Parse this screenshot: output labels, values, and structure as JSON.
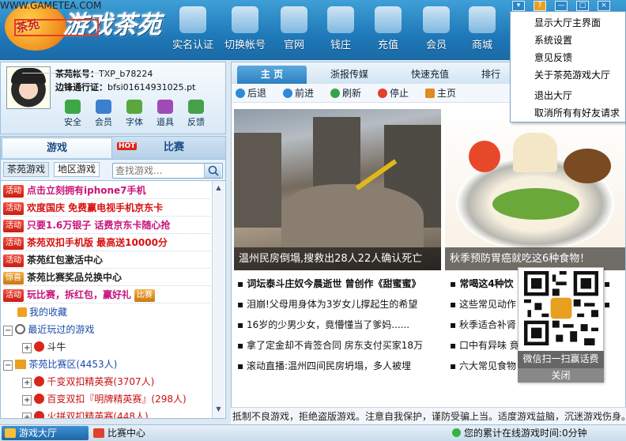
{
  "header": {
    "logo_text": "游戏茶苑",
    "logo_badge": "茶苑",
    "logo_url": "WWW.GAMETEA.COM",
    "nav": [
      {
        "label": "实名认证",
        "icon": "id-card-icon"
      },
      {
        "label": "切换帐号",
        "icon": "switch-account-icon"
      },
      {
        "label": "官网",
        "icon": "home-icon"
      },
      {
        "label": "钱庄",
        "icon": "bank-icon"
      },
      {
        "label": "充值",
        "icon": "recharge-icon"
      },
      {
        "label": "会员",
        "icon": "diamond-icon"
      },
      {
        "label": "商城",
        "icon": "cart-icon"
      }
    ],
    "window_controls": [
      "▾",
      "?",
      "—",
      "□",
      "×"
    ]
  },
  "menu": {
    "items": [
      "显示大厅主界面",
      "系统设置",
      "意见反馈",
      "关于茶苑游戏大厅",
      "退出大厅",
      "取消所有有好友请求"
    ],
    "highlighted": "系统设置"
  },
  "profile": {
    "account_label": "茶苑帐号：",
    "account_value": "TXP_b78224",
    "pass_label": "边锋通行证：",
    "pass_value": "bfsi01614931025.pt",
    "tools": [
      "安全",
      "会员",
      "字体",
      "道具",
      "反馈"
    ]
  },
  "left_tabs": {
    "games": "游戏",
    "hot_badge": "HOT",
    "match": "比赛"
  },
  "sub_tabs": [
    "茶苑游戏",
    "地区游戏"
  ],
  "search": {
    "placeholder": "查找游戏..."
  },
  "game_list": [
    {
      "badge": "活动",
      "text": "点击立刻拥有iphone7手机",
      "color": "#c8137a"
    },
    {
      "badge": "活动",
      "text": "欢度国庆 免费赢电视手机京东卡",
      "color": "#d81010"
    },
    {
      "badge": "活动",
      "text": "只要1.6万银子 话费京东卡随心抢",
      "color": "#c8137a"
    },
    {
      "badge": "活动",
      "text": "茶苑双扣手机版 最高送10000分",
      "color": "#d81010"
    },
    {
      "badge": "活动",
      "text": "茶苑红包激活中心",
      "color": "#111"
    },
    {
      "badge": "惊喜",
      "text": "茶苑比赛奖品兑换中心",
      "color": "#111"
    },
    {
      "badge": "活动",
      "text": "玩比赛，拆红包，赢好礼",
      "color": "#c8137a",
      "tag": "比赛"
    },
    {
      "text": "我的收藏",
      "color": "#1a4aa8"
    },
    {
      "text": "最近玩过的游戏",
      "color": "#1a4aa8"
    },
    {
      "text": "斗牛",
      "color": "#111"
    },
    {
      "text": "茶苑比赛区(4453人)",
      "color": "#1a4aa8"
    },
    {
      "text": "千变双扣精英赛(3707人)",
      "color": "#c81010"
    },
    {
      "text": "百变双扣『明牌精英赛』(298人)",
      "color": "#c81010"
    },
    {
      "text": "火拼双扣精英赛(448人)",
      "color": "#c81010"
    }
  ],
  "content_tabs": [
    "主 页",
    "浙报传媒",
    "快速充值",
    "排行"
  ],
  "navbar": [
    "后退",
    "前进",
    "刷新",
    "停止",
    "主页"
  ],
  "news": {
    "caption_left": "温州民房倒塌,搜救出28人22人确认死亡",
    "caption_right": "秋季预防胃癌就吃这6种食物！",
    "left": [
      {
        "text": "词坛泰斗庄奴今晨逝世 曾创作《甜蜜蜜》",
        "bold": true
      },
      {
        "text": "泪崩!父母用身体为3岁女儿撑起生的希望"
      },
      {
        "text": "16岁的少男少女，竟懵懂当了爹妈......"
      },
      {
        "text": "拿了定金却不肯签合同 房东支付买家18万"
      },
      {
        "text": "滚动直播:温州四间民房坍塌，多人被埋"
      }
    ],
    "right": [
      {
        "text": "常喝这4种饮",
        "bold": true
      },
      {
        "text": "这些常见动作"
      },
      {
        "text": "秋季适合补肾"
      },
      {
        "text": "口中有异味 竟"
      },
      {
        "text": "六大常见食物"
      }
    ]
  },
  "qr": {
    "caption": "微信扫一扫赢话费",
    "close": "关闭"
  },
  "ticker": "抵制不良游戏，拒绝盗版游戏。注意自我保护，谨防受骗上当。适度游戏益脑，沉迷游戏伤身。",
  "bottom": {
    "hall": "游戏大厅",
    "match": "比赛中心",
    "online_time": "您的累计在线游戏时间:0分钟"
  }
}
